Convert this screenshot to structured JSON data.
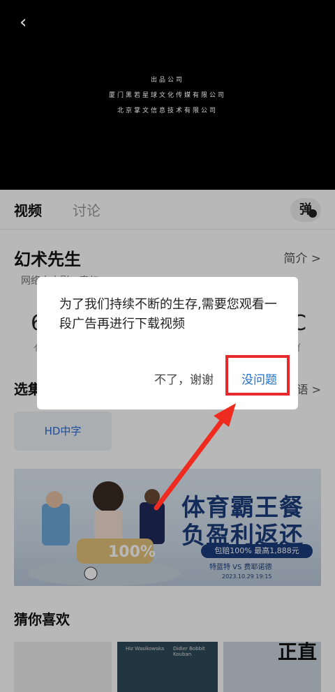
{
  "video": {
    "credit_heading": "出品公司",
    "credit_line1": "厦门黑若星球文化传媒有限公司",
    "credit_line2": "北京掌文信息技术有限公司"
  },
  "tabs": [
    {
      "label": "视频"
    },
    {
      "label": "讨论"
    }
  ],
  "danmu_label": "弹",
  "show": {
    "title": "幻术先生",
    "intro_label": "简介 >",
    "subline": "网络大电影 · 奇幻"
  },
  "stats": {
    "left_big": "6",
    "left_small": "亻",
    "right_big": "C",
    "right_small": "亻"
  },
  "episodes": {
    "section_label": "选集",
    "lang_label": "语 >",
    "items": [
      "HD中字"
    ]
  },
  "ad": {
    "line1": "体育霸王餐",
    "line2": "负盈利返还",
    "pill": "包赔100% 最高1,888元",
    "match": "特蓝特  VS  费耶诺德",
    "date": "2023.10.29 19:15"
  },
  "guess": {
    "title": "猜你喜欢",
    "thumb2_name1": "Hiz Wasikowska",
    "thumb2_name2": "Didier Bobbit Kouban",
    "thumb3_text": "正直"
  },
  "dialog": {
    "message": "为了我们持续不断的生存,需要您观看一段广告再进行下载视频",
    "decline": "不了，谢谢",
    "accept": "没问题"
  },
  "colors": {
    "accent": "#1f6fcf",
    "highlight": "#e8282b"
  }
}
